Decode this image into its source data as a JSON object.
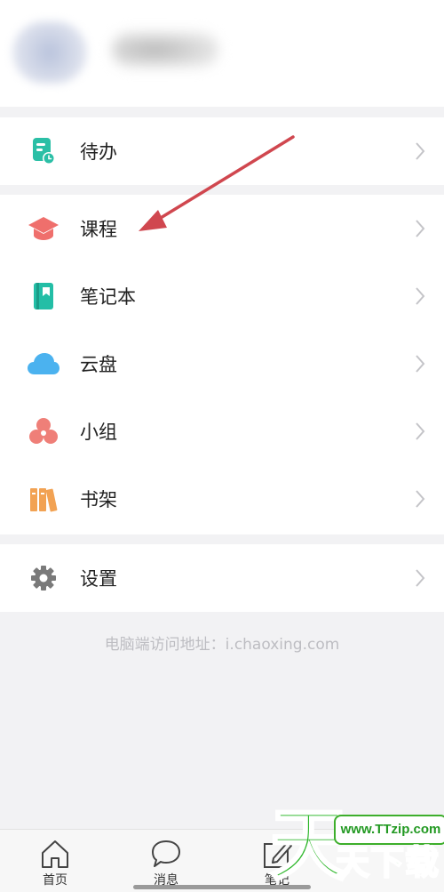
{
  "menu": {
    "todo": "待办",
    "course": "课程",
    "notebook": "笔记本",
    "cloud": "云盘",
    "group": "小组",
    "bookshelf": "书架",
    "settings": "设置"
  },
  "footer_note": "电脑端访问地址：i.chaoxing.com",
  "tabs": {
    "home": "首页",
    "messages": "消息",
    "notes": "笔记"
  },
  "watermark": {
    "big": "天",
    "small": "天下载",
    "url": "www.TTzip.com"
  },
  "colors": {
    "todo_icon": "#2bbfa6",
    "course_icon": "#ef6f6c",
    "notebook_icon": "#23bea6",
    "cloud_icon": "#4bb2ef",
    "group_icon": "#ef7f78",
    "bookshelf_icon": "#f2a253",
    "settings_icon": "#7a7a7a",
    "arrow": "#d0474f",
    "watermark_green": "#2db72a"
  }
}
